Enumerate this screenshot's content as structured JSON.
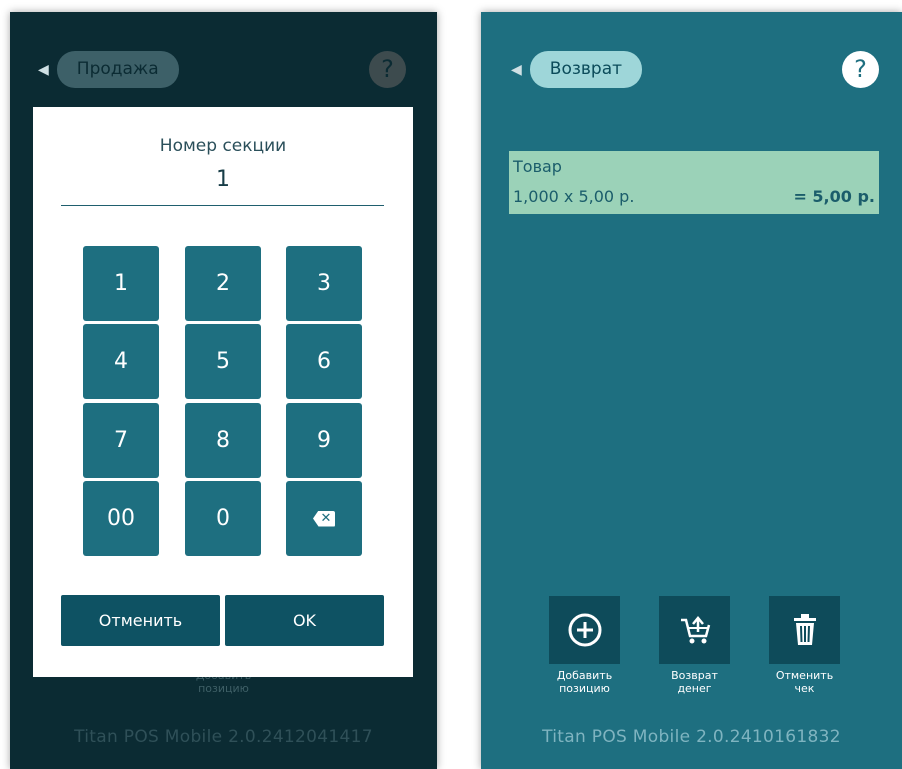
{
  "left_screen": {
    "mode_label": "Продажа",
    "help_icon": "?",
    "dialog": {
      "title": "Номер секции",
      "value": "1",
      "keys": [
        "1",
        "2",
        "3",
        "4",
        "5",
        "6",
        "7",
        "8",
        "9",
        "00",
        "0"
      ],
      "backspace_icon": "backspace-icon",
      "cancel_label": "Отменить",
      "ok_label": "OK"
    },
    "hidden_action_label": "Добавить позицию",
    "version": "Titan POS Mobile 2.0.2412041417"
  },
  "right_screen": {
    "mode_label": "Возврат",
    "help_icon": "?",
    "item": {
      "name": "Товар",
      "quantity_price": "1,000 x 5,00 р.",
      "total": "= 5,00 р."
    },
    "actions": [
      {
        "label": "Добавить позицию",
        "icon": "plus-circle-icon"
      },
      {
        "label": "Возврат денег",
        "icon": "cart-return-icon"
      },
      {
        "label": "Отменить чек",
        "icon": "trash-icon"
      }
    ],
    "version": "Titan POS Mobile 2.0.2410161832"
  },
  "colors": {
    "left_bg": "#0b2b33",
    "right_bg": "#1e6f80",
    "key_bg": "#1e6f80",
    "dialog_button_bg": "#0e5263",
    "item_bg": "#9bd2b8"
  }
}
